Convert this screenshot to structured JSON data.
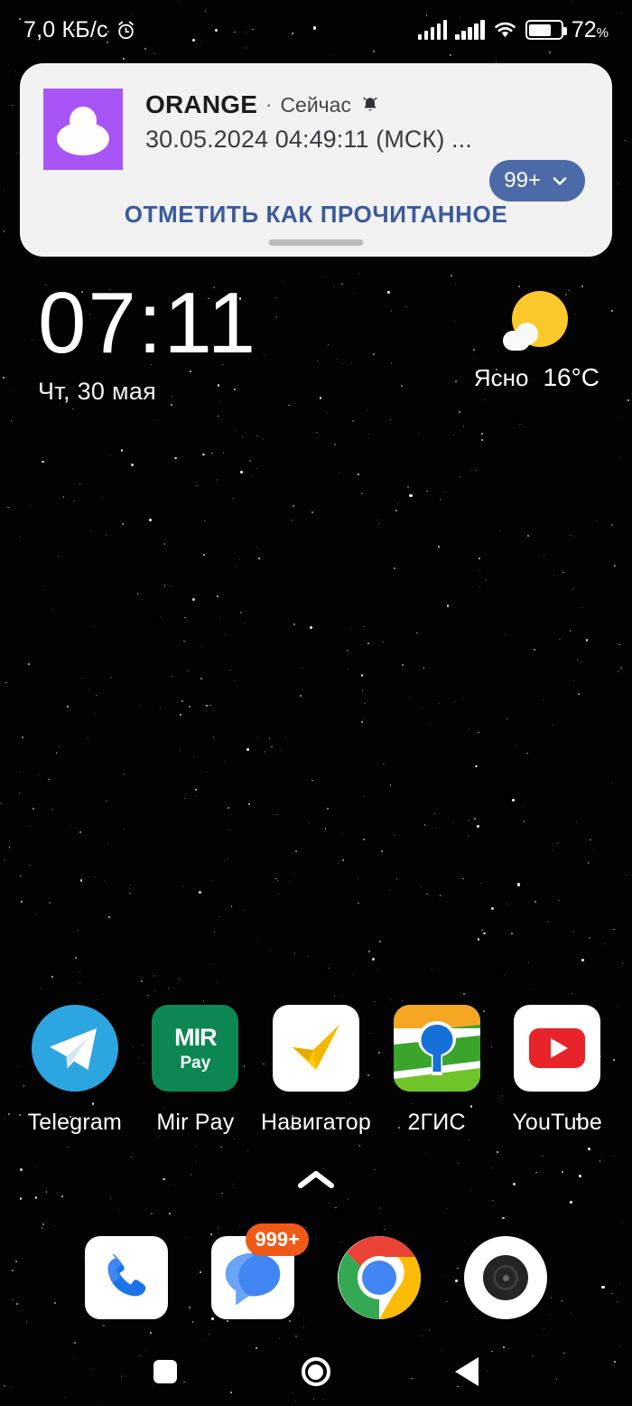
{
  "status_bar": {
    "network_speed": "7,0 КБ/с",
    "alarm_icon": "alarm-clock-icon",
    "signal_icon_1": "cellular-signal-icon",
    "signal_icon_2": "cellular-signal-icon",
    "wifi_icon": "wifi-icon",
    "battery_icon": "battery-icon",
    "battery_percent": "72",
    "battery_percent_symbol": "%",
    "battery_level": 72
  },
  "notification": {
    "avatar_icon": "contact-avatar-icon",
    "app_name": "ORANGE",
    "separator": "·",
    "time": "Сейчас",
    "bell_icon": "bell-icon",
    "body": "30.05.2024 04:49:11 (МСК) ...",
    "count_label": "99+",
    "expand_icon": "chevron-down-icon",
    "action_label": "ОТМЕТИТЬ КАК ПРОЧИТАННОЕ",
    "drag_handle": "drag-handle",
    "accent_color": "#4d6aa8",
    "action_color": "#3b5a9e",
    "avatar_color": "#a855f7",
    "card_color": "#f2f2f2"
  },
  "clock_widget": {
    "time": "07:11",
    "date": "Чт, 30 мая"
  },
  "weather_widget": {
    "icon": "sun-behind-cloud-icon",
    "condition": "Ясно",
    "temperature": "16°C"
  },
  "home_apps": [
    {
      "label": "Telegram",
      "icon": "telegram-icon"
    },
    {
      "label": "Mir Pay",
      "icon": "mir-pay-icon",
      "brand_top": "MIR",
      "brand_bottom": "Pay"
    },
    {
      "label": "Навигатор",
      "icon": "yandex-navigator-icon"
    },
    {
      "label": "2ГИС",
      "icon": "2gis-icon"
    },
    {
      "label": "YouTube",
      "icon": "youtube-icon"
    }
  ],
  "app_drawer": {
    "arrow_icon": "chevron-up-icon"
  },
  "dock": [
    {
      "name": "phone",
      "icon": "phone-icon"
    },
    {
      "name": "messages",
      "icon": "messages-icon",
      "badge": "999+",
      "badge_color": "#ef5a17"
    },
    {
      "name": "chrome",
      "icon": "chrome-icon"
    },
    {
      "name": "camera",
      "icon": "camera-icon"
    }
  ],
  "navigation_bar": [
    {
      "name": "recents",
      "icon": "square-icon"
    },
    {
      "name": "home",
      "icon": "circle-icon"
    },
    {
      "name": "back",
      "icon": "triangle-back-icon"
    }
  ]
}
